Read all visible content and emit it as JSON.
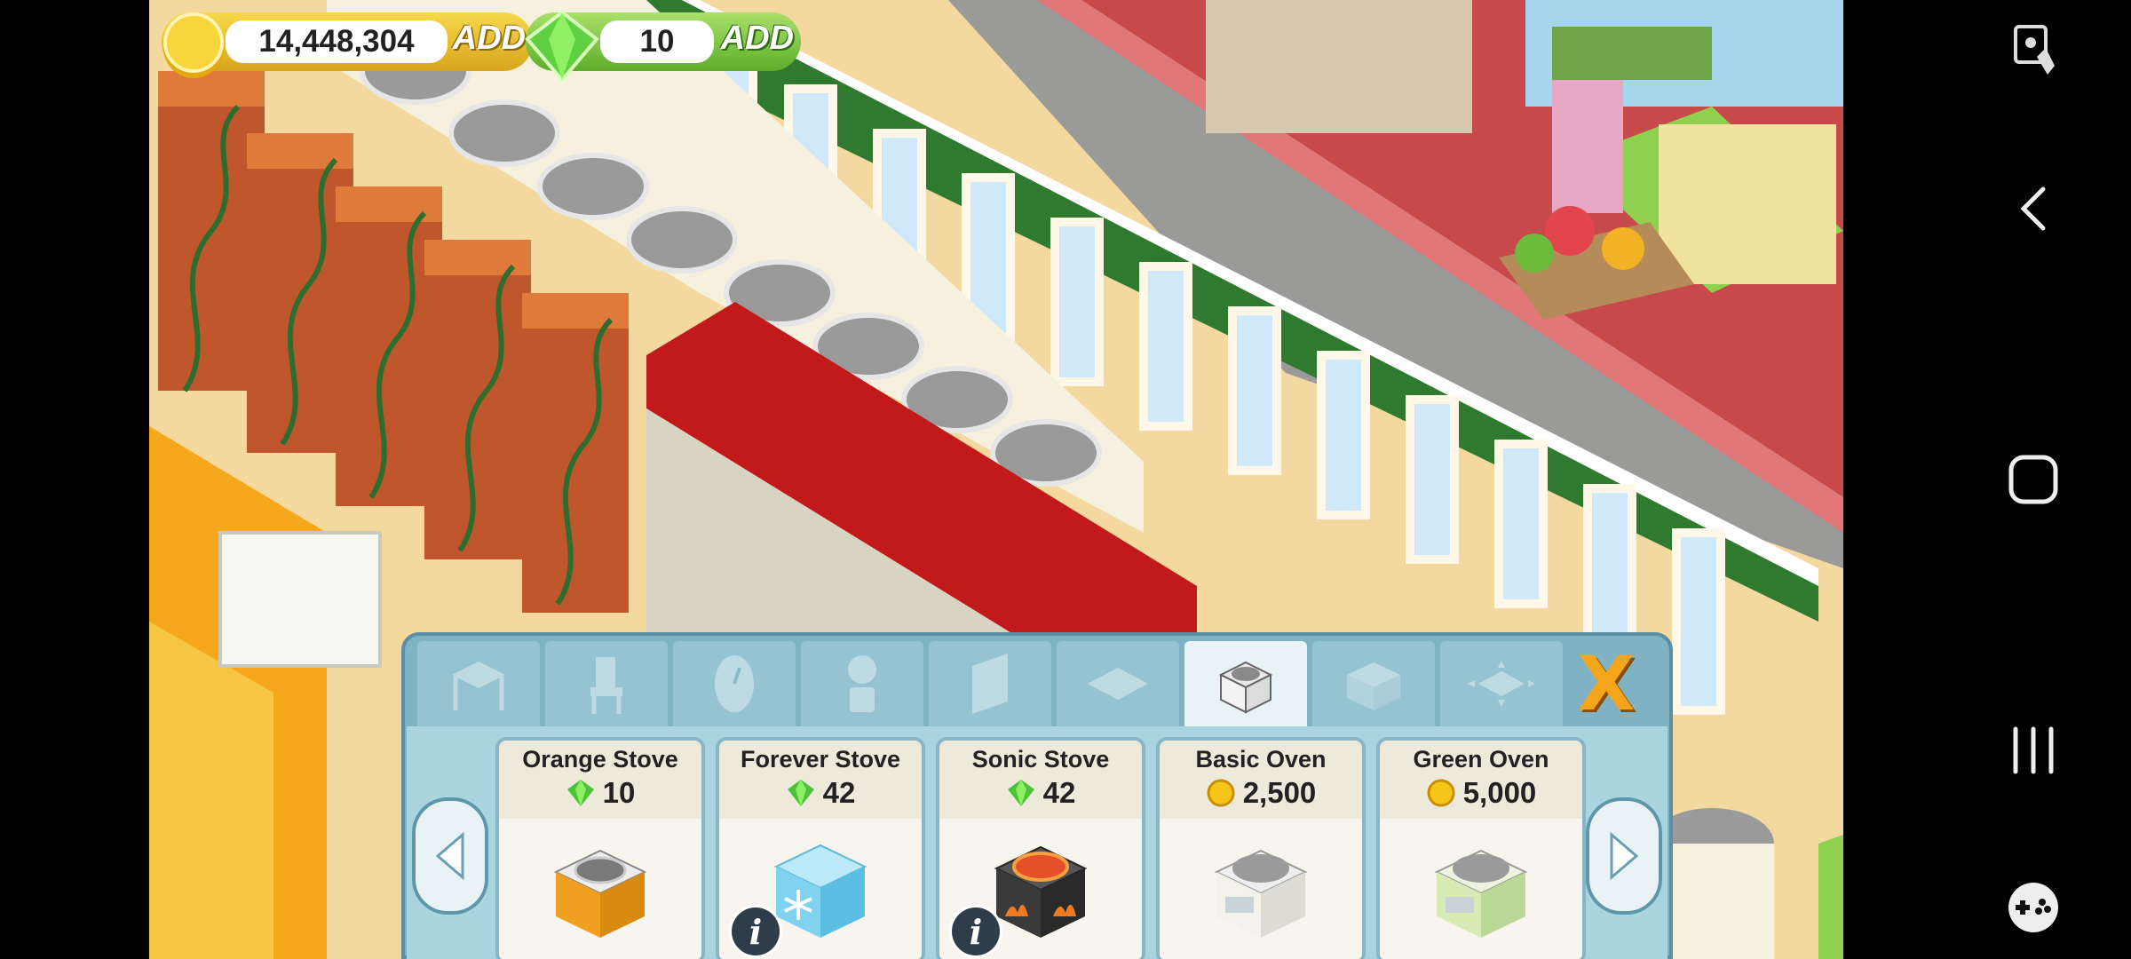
{
  "currency": {
    "coins": {
      "value": "14,448,304",
      "add_label": "ADD"
    },
    "gems": {
      "value": "10",
      "add_label": "ADD"
    }
  },
  "tabs": [
    {
      "name": "tables",
      "icon": "table-icon"
    },
    {
      "name": "chairs",
      "icon": "chair-icon"
    },
    {
      "name": "wall-decor",
      "icon": "clock-icon"
    },
    {
      "name": "decorations",
      "icon": "plant-icon"
    },
    {
      "name": "walls",
      "icon": "wall-icon"
    },
    {
      "name": "floors",
      "icon": "floor-tile-icon"
    },
    {
      "name": "stoves",
      "icon": "stove-icon",
      "active": true
    },
    {
      "name": "counters",
      "icon": "counter-icon"
    },
    {
      "name": "expansion",
      "icon": "expand-icon"
    }
  ],
  "close_label": "X",
  "items": [
    {
      "name": "Orange Stove",
      "price": "10",
      "currency": "gem",
      "info": false
    },
    {
      "name": "Forever Stove",
      "price": "42",
      "currency": "gem",
      "info": true
    },
    {
      "name": "Sonic Stove",
      "price": "42",
      "currency": "gem",
      "info": true
    },
    {
      "name": "Basic Oven",
      "price": "2,500",
      "currency": "coin",
      "info": false
    },
    {
      "name": "Green Oven",
      "price": "5,000",
      "currency": "coin",
      "info": false
    }
  ],
  "info_label": "i",
  "colors": {
    "coin": "#f5c518",
    "gem": "#4cc23a",
    "panel": "#7fb3c4",
    "close": "#f4a51a"
  }
}
